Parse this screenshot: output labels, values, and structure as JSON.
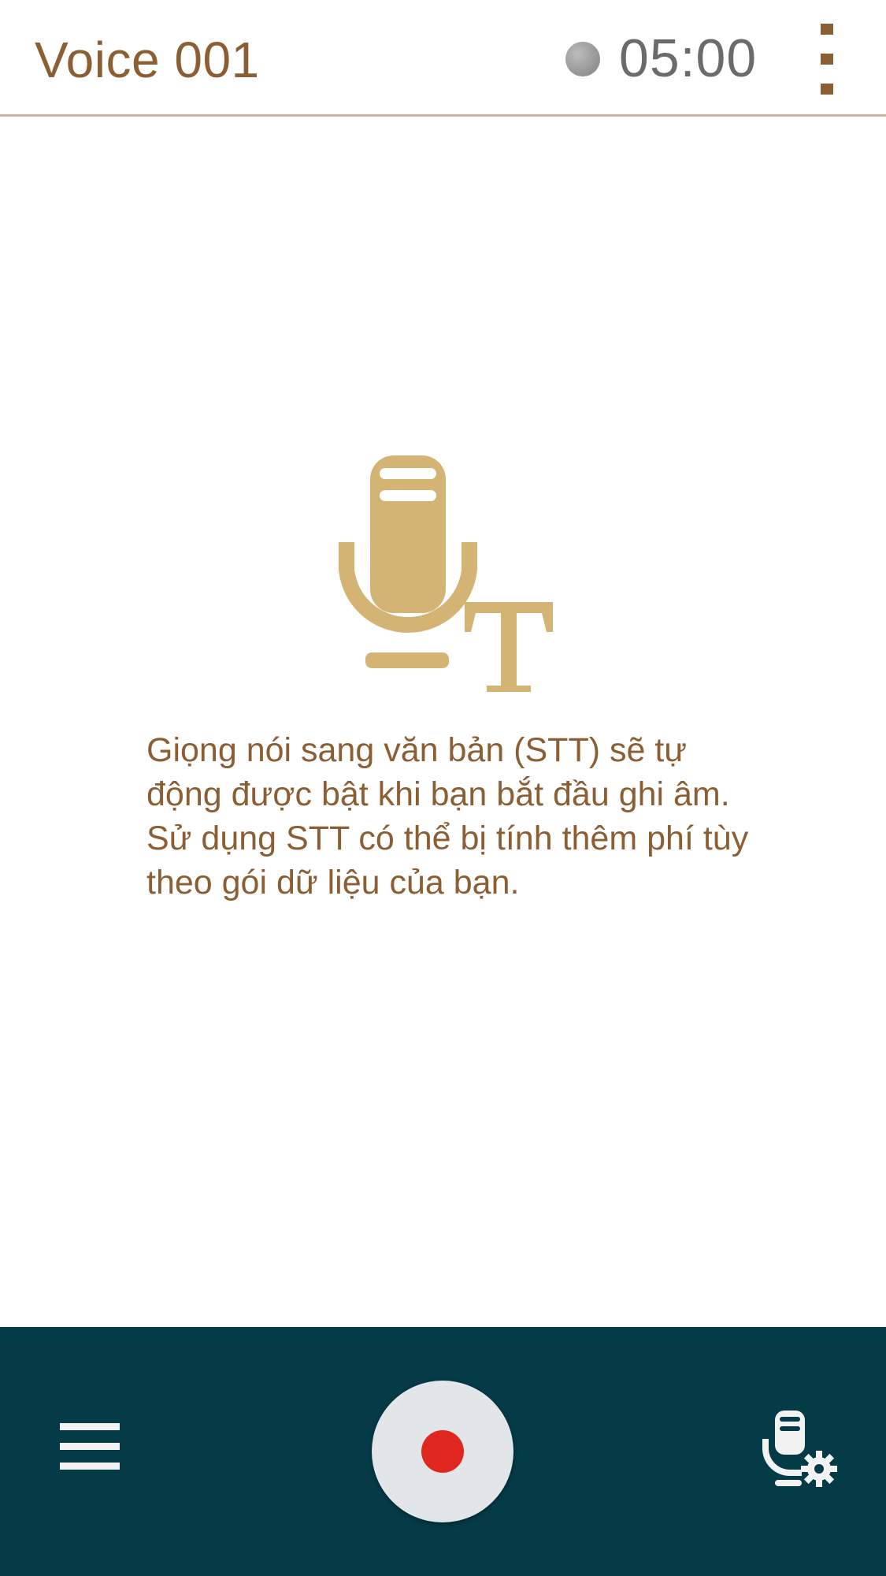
{
  "header": {
    "title": "Voice 001",
    "timer": "05:00",
    "status_indicator": "recording-status-dot",
    "more_icon": "more-vert-icon"
  },
  "main": {
    "illustration_icon": "speech-to-text-icon",
    "message": "Giọng nói sang văn bản (STT) sẽ tự động được bật khi bạn bắt đầu ghi âm. Sử dụng STT có thể bị tính thêm phí tùy theo gói dữ liệu của bạn."
  },
  "bottom_bar": {
    "menu_icon": "hamburger-menu-icon",
    "record_icon": "record-icon",
    "stt_settings_icon": "stt-settings-icon"
  },
  "colors": {
    "title_brown": "#8c5e33",
    "icon_gold": "#d3b474",
    "bottom_bar": "#053a47",
    "record_red": "#e0271f",
    "record_button_bg": "#e3e6e8",
    "divider": "#c9b59a"
  }
}
